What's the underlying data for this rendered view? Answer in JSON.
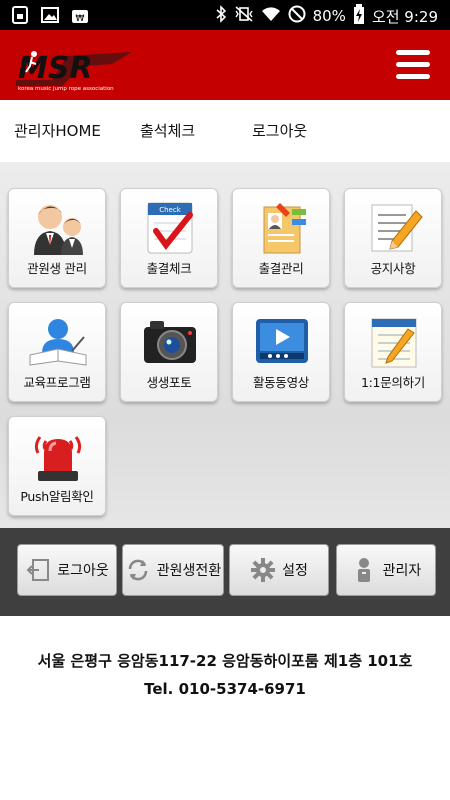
{
  "status_bar": {
    "battery": "80%",
    "time": "오전 9:29"
  },
  "header": {
    "logo_text": "MSR",
    "logo_subtext": "korea music jump rope association"
  },
  "top_nav": [
    {
      "label": "관리자HOME"
    },
    {
      "label": "출석체크"
    },
    {
      "label": "로그아웃"
    }
  ],
  "tiles": [
    {
      "label": "관원생 관리",
      "icon": "students-icon"
    },
    {
      "label": "출결체크",
      "icon": "check-clipboard-icon"
    },
    {
      "label": "출결관리",
      "icon": "attendance-notebook-icon"
    },
    {
      "label": "공지사항",
      "icon": "notice-pencil-icon"
    },
    {
      "label": "교육프로그램",
      "icon": "education-reader-icon"
    },
    {
      "label": "생생포토",
      "icon": "camera-icon"
    },
    {
      "label": "활동동영상",
      "icon": "video-player-icon"
    },
    {
      "label": "1:1문의하기",
      "icon": "notepad-icon"
    },
    {
      "label": "Push알림확인",
      "icon": "siren-icon"
    }
  ],
  "bottom_buttons": [
    {
      "label": "로그아웃",
      "icon": "logout-icon"
    },
    {
      "label": "관원생전환",
      "icon": "refresh-icon"
    },
    {
      "label": "설정",
      "icon": "gear-icon"
    },
    {
      "label": "관리자",
      "icon": "admin-person-icon"
    }
  ],
  "footer": {
    "address": "서울 은평구 응암동117-22 응암동하이포룸 제1층 101호",
    "tel": "Tel. 010-5374-6971"
  }
}
